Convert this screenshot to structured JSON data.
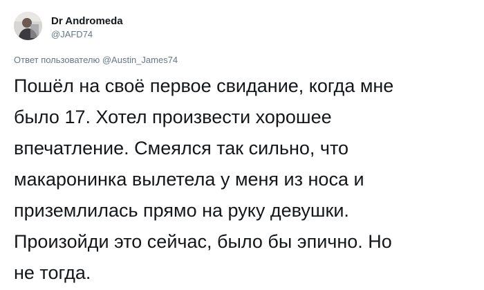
{
  "author": {
    "display_name": "Dr Andromeda",
    "handle": "@JAFD74",
    "avatar_icon": "user-avatar-icon"
  },
  "reply": {
    "prefix": "Ответ пользователю",
    "to_handle": "@Austin_James74"
  },
  "tweet": {
    "lines": [
      "Пошёл на своё первое свидание, когда мне",
      "было 17. Хотел произвести хорошее",
      "впечатление. Смеялся так сильно, что",
      "макаронинка вылетела у меня из носа и",
      "приземлилась прямо на руку девушки.",
      "Произойди это сейчас, было бы эпично. Но",
      "не тогда."
    ]
  },
  "colors": {
    "text_primary": "#14171a",
    "text_secondary": "#657786",
    "background": "#ffffff"
  }
}
